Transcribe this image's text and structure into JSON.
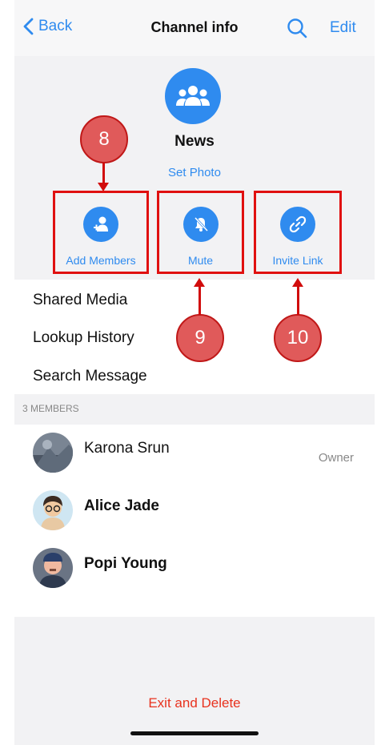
{
  "navbar": {
    "back_label": "Back",
    "title": "Channel info",
    "edit_label": "Edit"
  },
  "channel": {
    "name": "News",
    "set_photo": "Set Photo"
  },
  "actions": {
    "add_members": "Add Members",
    "mute": "Mute",
    "invite_link": "Invite Link"
  },
  "menu": {
    "shared_media": "Shared Media",
    "lookup_history": "Lookup History",
    "search_message": "Search Message"
  },
  "members": {
    "header": "3 MEMBERS",
    "list": [
      {
        "name": "Karona Srun",
        "role": "Owner"
      },
      {
        "name": "Alice Jade",
        "role": ""
      },
      {
        "name": "Popi Young",
        "role": ""
      }
    ]
  },
  "footer": {
    "exit_label": "Exit and Delete"
  },
  "annotations": {
    "badge_8": "8",
    "badge_9": "9",
    "badge_10": "10"
  },
  "colors": {
    "accent": "#2f8bef",
    "destructive": "#e8321e",
    "annotation_red": "#e01010"
  }
}
